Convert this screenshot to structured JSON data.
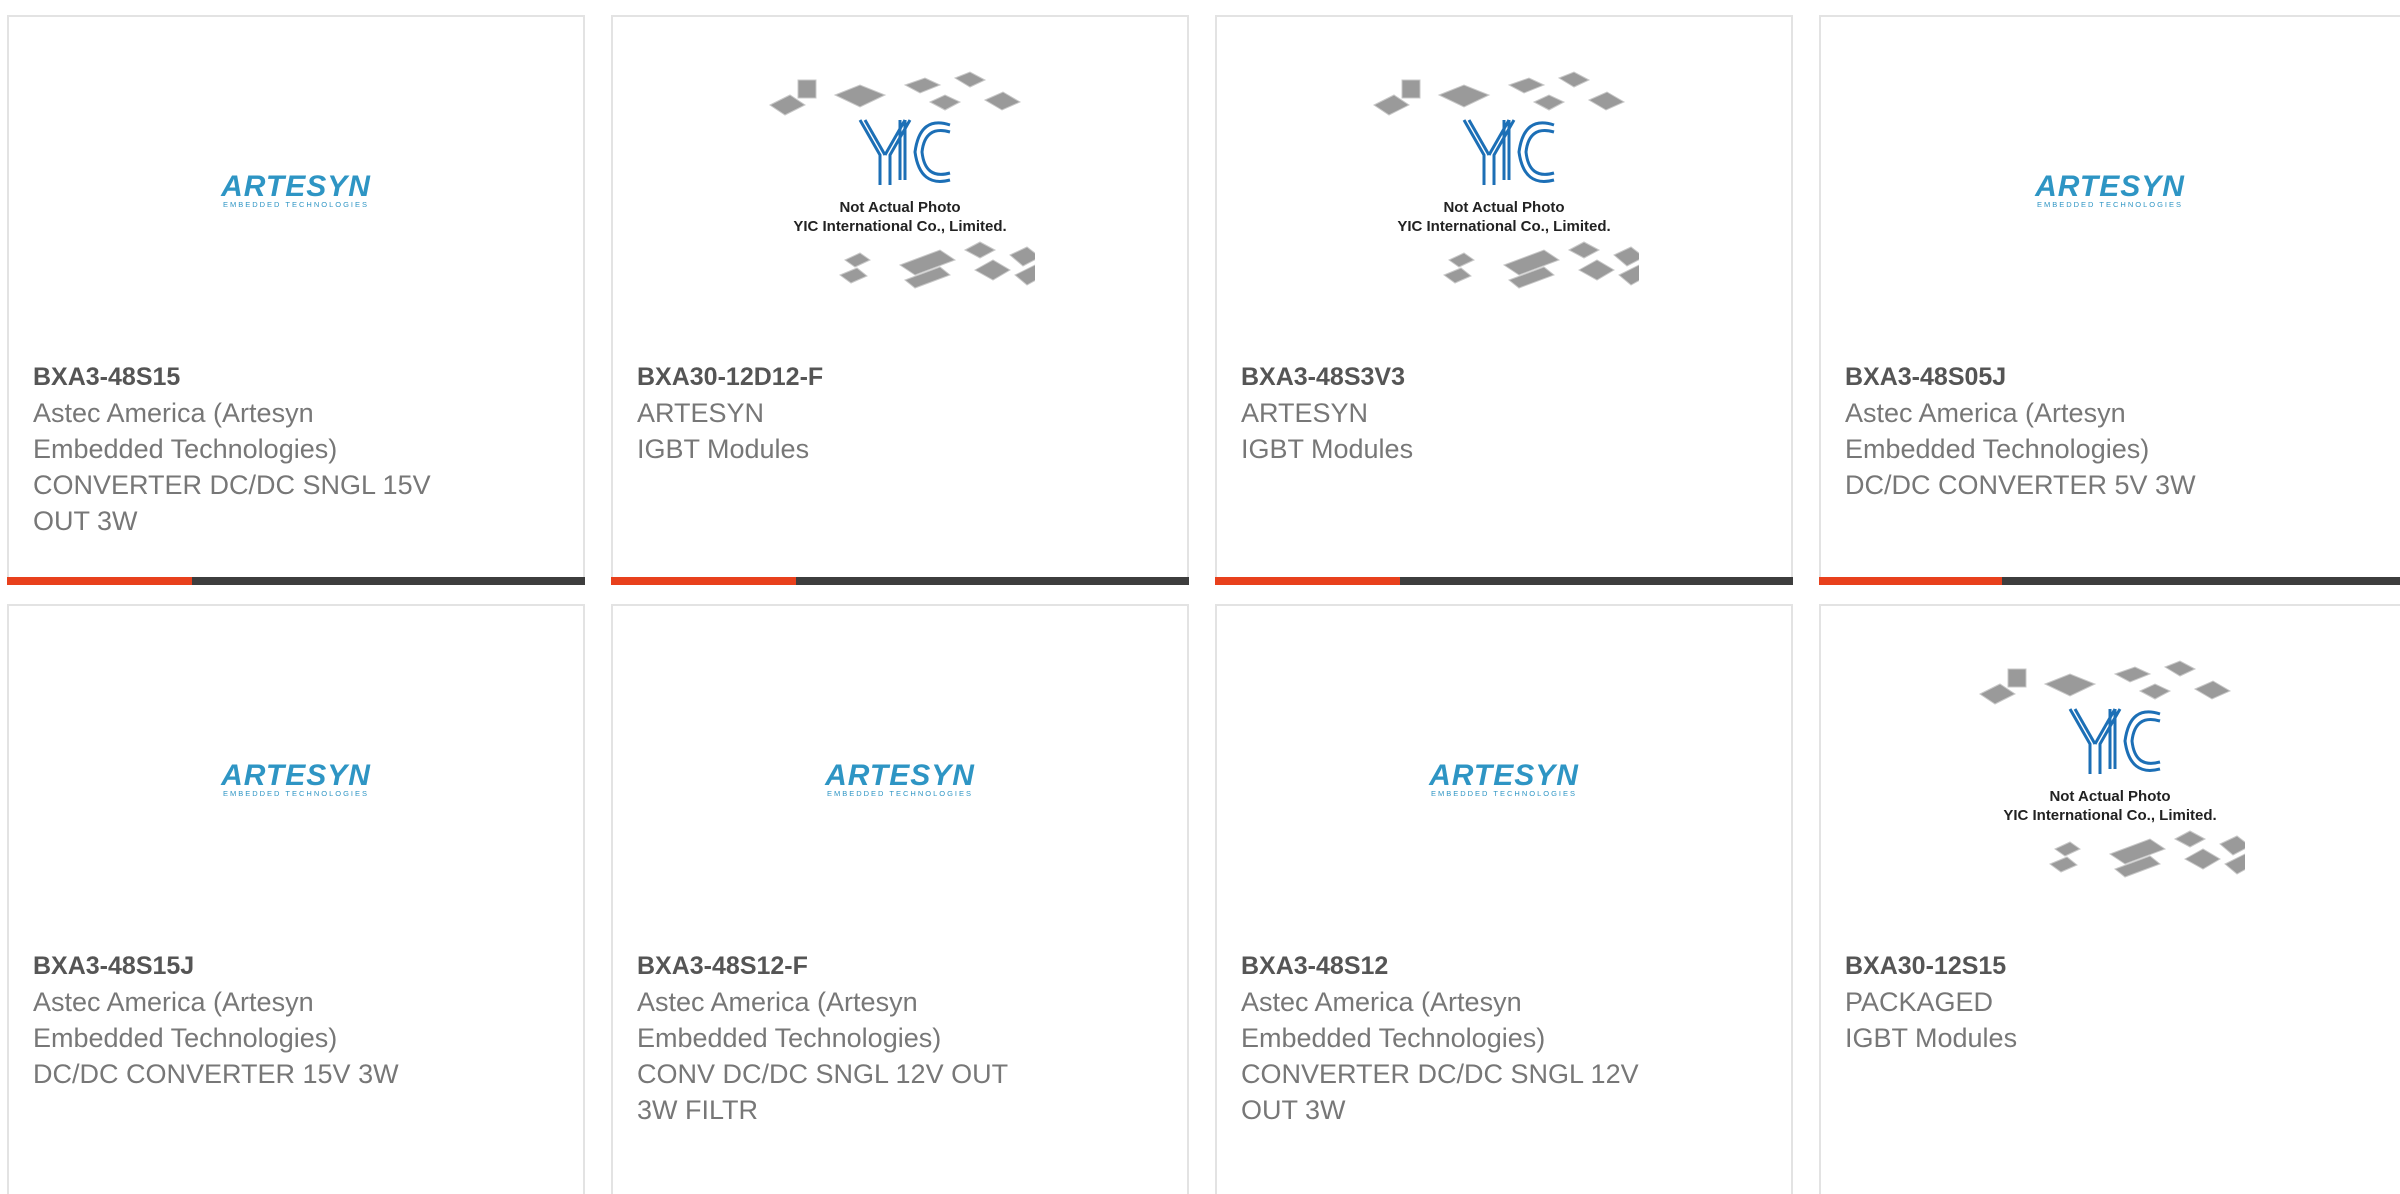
{
  "colors": {
    "accent": "#e8401c",
    "bar": "#3d3d3d",
    "border": "#e3e3e3",
    "part_number": "#555555",
    "text": "#777777",
    "artesyn_blue": "#2e95c4",
    "yic_blue": "#1c6fb6"
  },
  "logos": {
    "artesyn": {
      "name": "ARTESYN",
      "tagline": "EMBEDDED TECHNOLOGIES"
    },
    "yic": {
      "name": "YIC",
      "line1": "Not Actual Photo",
      "line2": "YIC International Co., Limited."
    }
  },
  "products": [
    {
      "part_number": "BXA3-48S15",
      "image": "artesyn-logo",
      "lines": [
        "Astec America (Artesyn",
        "Embedded Technologies)",
        "CONVERTER DC/DC SNGL 15V",
        "OUT 3W"
      ]
    },
    {
      "part_number": "BXA30-12D12-F",
      "image": "yic-placeholder",
      "lines": [
        "ARTESYN",
        "IGBT Modules"
      ]
    },
    {
      "part_number": "BXA3-48S3V3",
      "image": "yic-placeholder",
      "lines": [
        "ARTESYN",
        "IGBT Modules"
      ]
    },
    {
      "part_number": "BXA3-48S05J",
      "image": "artesyn-logo",
      "lines": [
        "Astec America (Artesyn",
        "Embedded Technologies)",
        "DC/DC CONVERTER 5V 3W"
      ]
    },
    {
      "part_number": "BXA3-48S15J",
      "image": "artesyn-logo",
      "lines": [
        "Astec America (Artesyn",
        "Embedded Technologies)",
        "DC/DC CONVERTER 15V 3W"
      ]
    },
    {
      "part_number": "BXA3-48S12-F",
      "image": "artesyn-logo",
      "lines": [
        "Astec America (Artesyn",
        "Embedded Technologies)",
        "CONV DC/DC SNGL 12V OUT",
        "3W FILTR"
      ]
    },
    {
      "part_number": "BXA3-48S12",
      "image": "artesyn-logo",
      "lines": [
        "Astec America (Artesyn",
        "Embedded Technologies)",
        "CONVERTER DC/DC SNGL 12V",
        "OUT 3W"
      ]
    },
    {
      "part_number": "BXA30-12S15",
      "image": "yic-placeholder",
      "lines": [
        "PACKAGED",
        "IGBT Modules"
      ]
    }
  ]
}
